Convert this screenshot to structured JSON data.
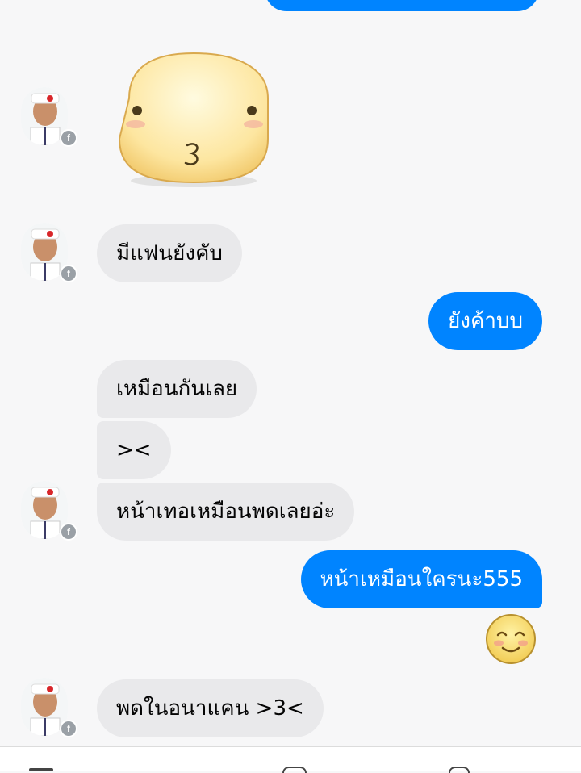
{
  "messages": {
    "m1": "มีแฟนยังคับ",
    "m2": "ยังค้าบบ",
    "m3": "เหมือนกันเลย",
    "m4": "><",
    "m5": "หน้าเทอเหมือนพดเลยอ่ะ",
    "m6": "หน้าเหมือนใครนะ555",
    "m7": "พดในอนาแคน >3<"
  },
  "icons": {
    "sticker": "kissing-face-sticker",
    "emoji": "smiling-face-emoji",
    "avatar": "contact-avatar",
    "badge": "facebook-badge-icon"
  },
  "colors": {
    "outgoing": "#0084ff",
    "incoming": "#e9e9eb",
    "background": "#f7f7f8"
  }
}
